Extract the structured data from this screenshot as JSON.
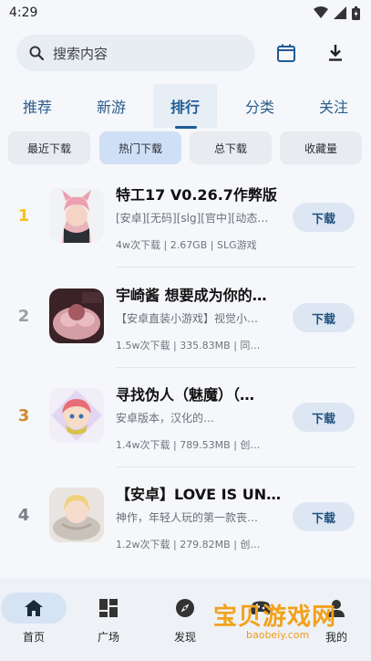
{
  "status_bar": {
    "time": "4:29"
  },
  "search": {
    "placeholder": "搜索内容"
  },
  "tabs": [
    {
      "label": "推荐"
    },
    {
      "label": "新游"
    },
    {
      "label": "排行"
    },
    {
      "label": "分类"
    },
    {
      "label": "关注"
    }
  ],
  "active_tab": "排行",
  "filters": [
    {
      "label": "最近下载"
    },
    {
      "label": "热门下载"
    },
    {
      "label": "总下载"
    },
    {
      "label": "收藏量"
    }
  ],
  "active_filter": "热门下载",
  "items": [
    {
      "rank": "1",
      "title": "特工17 V0.26.7作弊版",
      "desc": "[安卓][无码][slg][官中][动态…",
      "meta": "4w次下载 | 2.67GB | SLG游戏",
      "button": "下载",
      "rank_color": "#f4c41c"
    },
    {
      "rank": "2",
      "title": "宇崎酱 想要成为你的…",
      "desc": "【安卓直装小游戏】视觉小…",
      "meta": "1.5w次下载 | 335.83MB | 同…",
      "button": "下载",
      "rank_color": "#9aa0a6"
    },
    {
      "rank": "3",
      "title": "寻找伪人（魅魔）（…",
      "desc": "安卓版本，汉化的…",
      "meta": "1.4w次下载 | 789.53MB | 创…",
      "button": "下载",
      "rank_color": "#d08a2d"
    },
    {
      "rank": "4",
      "title": "【安卓】LOVE IS UN…",
      "desc": "神作，年轻人玩的第一款丧…",
      "meta": "1.2w次下载 | 279.82MB | 创…",
      "button": "下载",
      "rank_color": "#7b7f86"
    }
  ],
  "bottom_nav": [
    {
      "label": "首页",
      "icon": "home-icon"
    },
    {
      "label": "广场",
      "icon": "grid-icon"
    },
    {
      "label": "发现",
      "icon": "compass-icon"
    },
    {
      "label": "",
      "icon": "gamepad-icon"
    },
    {
      "label": "我的",
      "icon": "person-icon"
    }
  ],
  "watermark": {
    "text": "宝贝游戏网",
    "sub": "baobeiy.com"
  },
  "colors": {
    "accent": "#1f5b92",
    "download_btn_bg": "#dde7f3",
    "active_filter_bg": "#cfe0f6"
  }
}
